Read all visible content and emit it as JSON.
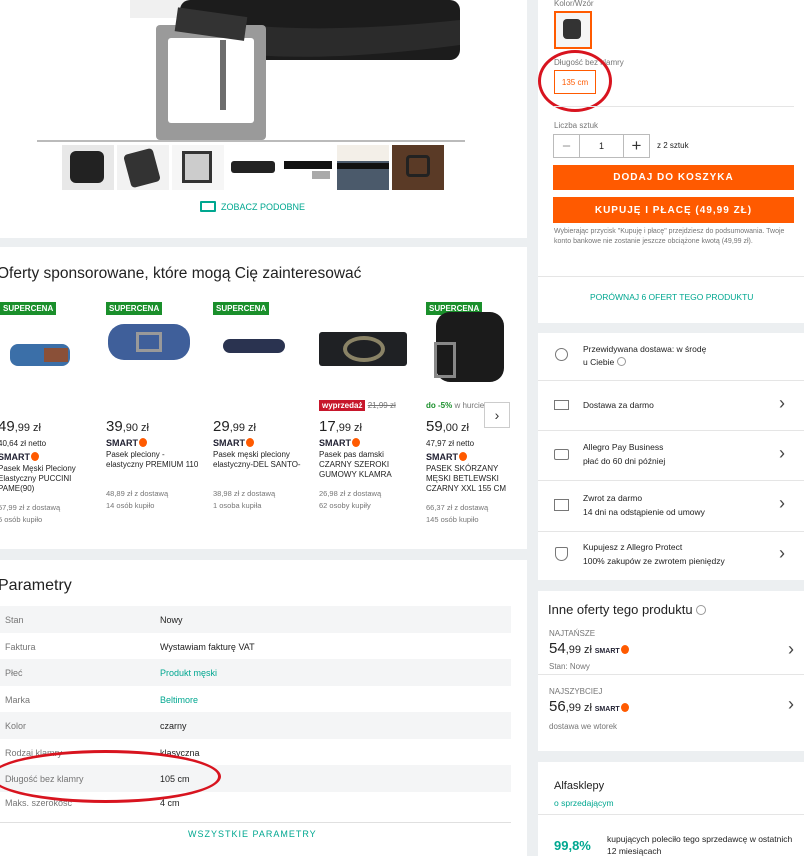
{
  "product": {
    "color_label": "Kolor/Wzór",
    "length_label": "Długość bez klamry",
    "length_option": "135 cm",
    "qty_label": "Liczba sztuk",
    "qty_minus": "−",
    "qty_value": "1",
    "qty_plus": "+",
    "qty_of": "z 2 sztuk",
    "add_to_cart": "DODAJ DO KOSZYKA",
    "buy_now": "KUPUJĘ I PŁACĘ (49,99 ZŁ)",
    "notice": "Wybierając przycisk \"Kupuję i płacę\" przejdziesz do podsumowania. Twoje konto bankowe nie zostanie jeszcze obciążone kwotą (49,99 zł).",
    "compare": "PORÓWNAJ 6 OFERT TEGO PRODUKTU",
    "see_similar": "ZOBACZ PODOBNE"
  },
  "sponsored": {
    "title": "Oferty sponsorowane, które mogą Cię zainteresować",
    "badge": "SUPERCENA",
    "items": [
      {
        "price_int": "49",
        "price_dec": ",99 zł",
        "net": "40,64 zł netto",
        "smart": "SMART",
        "name": "Pasek Męski Pleciony Elastyczny PUCCINI PAME(90)",
        "delivery": "57,99 zł z dostawą",
        "bought": "5 osób kupiło"
      },
      {
        "price_int": "39",
        "price_dec": ",90 zł",
        "net": "",
        "smart": "SMART",
        "name": "Pasek pleciony - elastyczny PREMIUM 110",
        "delivery": "48,89 zł z dostawą",
        "bought": "14 osób kupiło"
      },
      {
        "price_int": "29",
        "price_dec": ",99 zł",
        "net": "",
        "smart": "SMART",
        "name": "Pasek męski pleciony elastyczny-DEL SANTO-",
        "delivery": "38,98 zł z dostawą",
        "bought": "1 osoba kupiła"
      },
      {
        "price_int": "17",
        "price_dec": ",99 zł",
        "net": "",
        "smart": "SMART",
        "name": "Pasek pas damski CZARNY SZEROKI GUMOWY KLAMRA",
        "delivery": "26,98 zł z dostawą",
        "bought": "62 osoby kupiły",
        "sale": "wyprzedaż",
        "old_price": "21,99 zł"
      },
      {
        "price_int": "59",
        "price_dec": ",00 zł",
        "net": "47,97 zł netto",
        "smart": "SMART",
        "name": "PASEK SKÓRZANY MĘSKI BETLEWSKI CZARNY XXL 155 CM",
        "delivery": "66,37 zł z dostawą",
        "bought": "145 osób kupiło",
        "promo": "do -5%",
        "promo_rest": "w hurcie"
      }
    ]
  },
  "params": {
    "title": "Parametry",
    "rows": [
      {
        "label": "Stan",
        "value": "Nowy"
      },
      {
        "label": "Faktura",
        "value": "Wystawiam fakturę VAT"
      },
      {
        "label": "Płeć",
        "value": "Produkt męski"
      },
      {
        "label": "Marka",
        "value": "Beltimore"
      },
      {
        "label": "Kolor",
        "value": "czarny"
      },
      {
        "label": "Rodzaj klamry",
        "value": "klasyczna"
      },
      {
        "label": "Długość bez klamry",
        "value": "105 cm"
      },
      {
        "label": "Maks. szerokość",
        "value": "4 cm"
      }
    ],
    "all_params": "WSZYSTKIE PARAMETRY"
  },
  "services": [
    {
      "title": "Przewidywana dostawa: w środę",
      "sub": "u Ciebie"
    },
    {
      "title": "Dostawa za darmo",
      "sub": ""
    },
    {
      "title": "Allegro Pay Business",
      "sub": "płać do 60 dni później"
    },
    {
      "title": "Zwrot za darmo",
      "sub": "14 dni na odstąpienie od umowy"
    },
    {
      "title": "Kupujesz z Allegro Protect",
      "sub": "100% zakupów ze zwrotem pieniędzy"
    }
  ],
  "other_offers": {
    "title": "Inne oferty tego produktu",
    "cheapest_label": "NAJTAŃSZE",
    "cheapest_int": "54",
    "cheapest_dec": ",99 zł",
    "cheapest_sub": "Stan: Nowy",
    "fastest_label": "NAJSZYBCIEJ",
    "fastest_int": "56",
    "fastest_dec": ",99 zł",
    "fastest_sub": "dostawa we wtorek",
    "smart": "SMART"
  },
  "seller": {
    "name": "Alfasklepy",
    "link": "o sprzedającym",
    "percent": "99,8%",
    "recommend": "kupujących poleciło tego sprzedawcę w ostatnich 12 miesiącach"
  },
  "colors": {
    "accent": "#ff5a00",
    "teal": "#00a790",
    "super": "#1a8f2b",
    "annotation": "#d8141f"
  }
}
